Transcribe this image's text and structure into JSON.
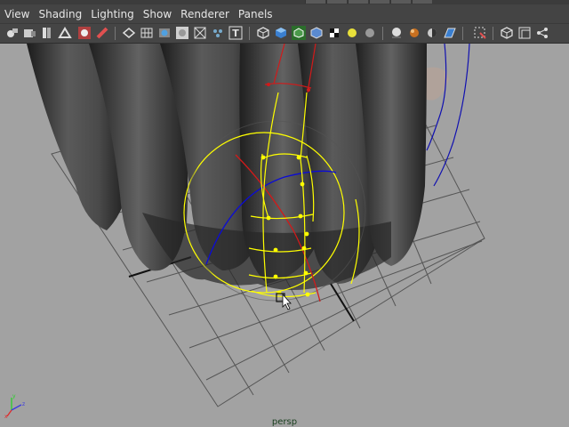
{
  "menubar": {
    "items": [
      {
        "id": "view",
        "label": "View"
      },
      {
        "id": "shading",
        "label": "Shading"
      },
      {
        "id": "lighting",
        "label": "Lighting"
      },
      {
        "id": "show",
        "label": "Show"
      },
      {
        "id": "renderer",
        "label": "Renderer"
      },
      {
        "id": "panels",
        "label": "Panels"
      }
    ]
  },
  "toolbar": {
    "icons": [
      "select-camera-icon",
      "camera-attributes-icon",
      "bookmark-icon",
      "image-plane-icon",
      "camera-lock-icon",
      "grease-pencil-icon",
      "wireframe-icon",
      "grid-icon",
      "resolution-gate-icon",
      "film-gate-icon",
      "safe-action-icon",
      "field-chart-icon",
      "text-icon",
      "wireframe-cube-icon",
      "smooth-shade-icon",
      "wireframe-on-shaded-icon",
      "textured-icon",
      "use-default-light-icon",
      "shadows-icon",
      "screen-space-ao-icon",
      "motion-blur-icon",
      "anti-alias-icon",
      "depth-of-field-icon",
      "xray-icon",
      "isolate-select-icon",
      "two-pane-icon",
      "share-icon"
    ]
  },
  "viewport": {
    "camera": "persp",
    "axis_labels": {
      "x": "x",
      "y": "y",
      "z": "z"
    },
    "colors": {
      "background": "#a2a2a2",
      "grid": "#555555",
      "manipulator": "#ffff00",
      "rotate_x_ring": "#d11a1a",
      "rotate_z_ring": "#0b0bd6",
      "curve": "#1010b0"
    }
  }
}
